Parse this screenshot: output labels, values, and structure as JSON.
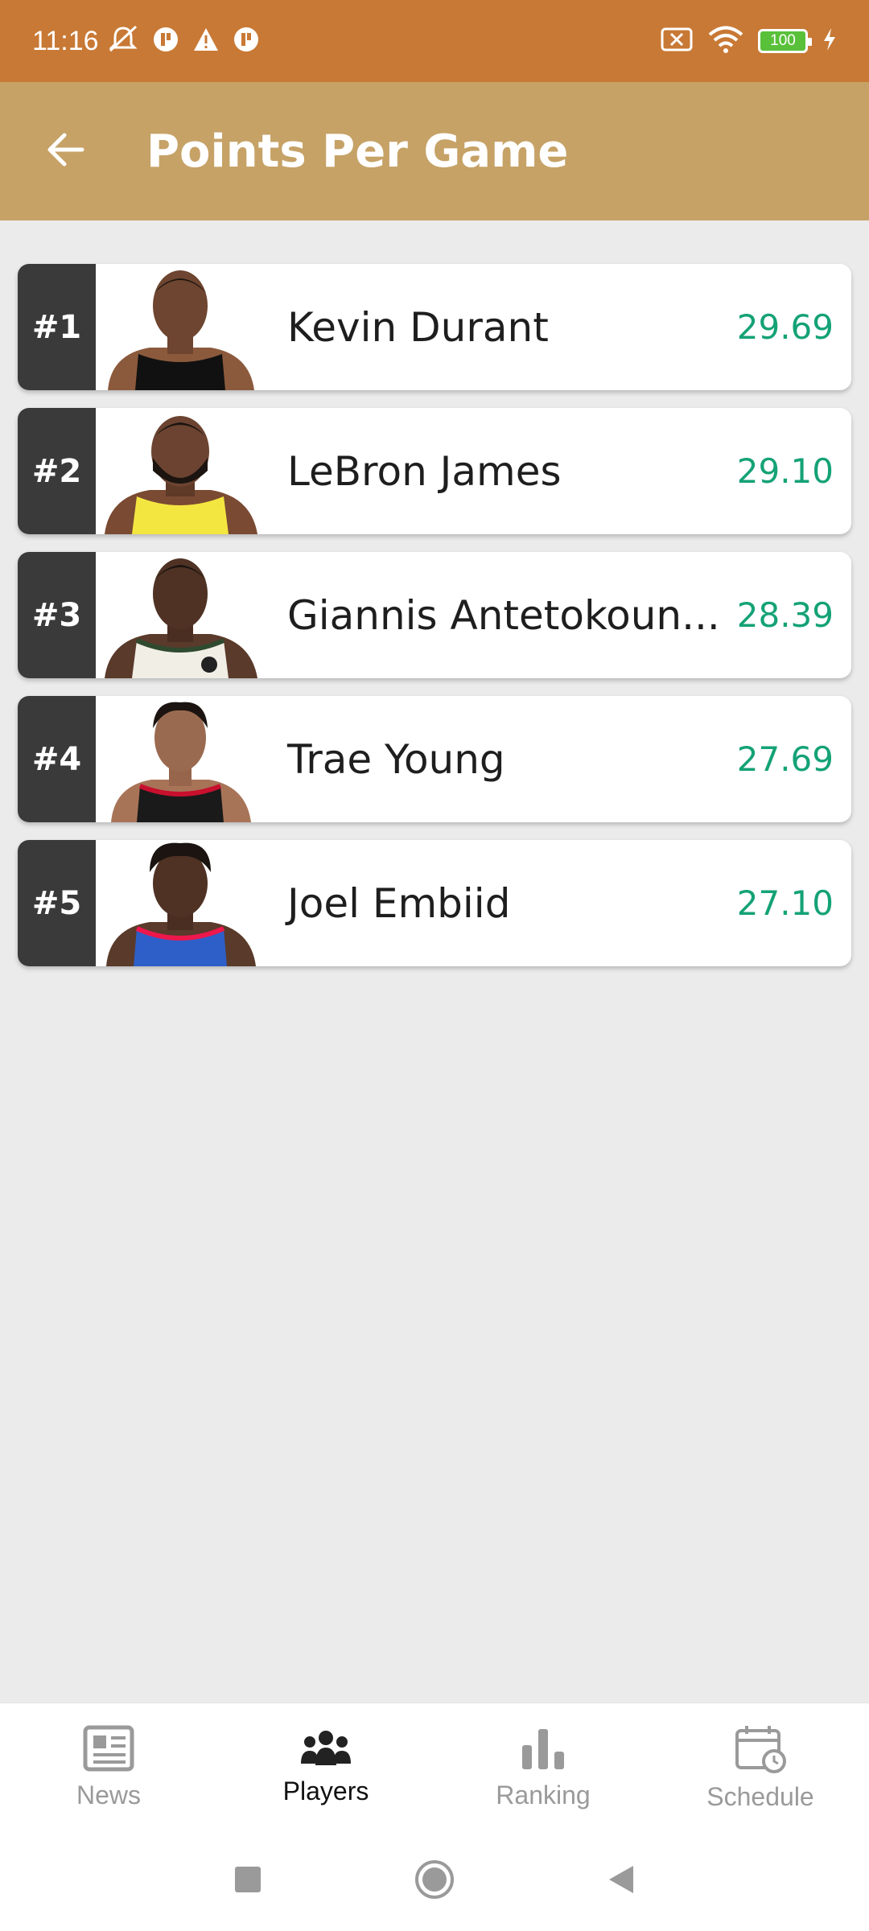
{
  "status_bar": {
    "time": "11:16",
    "battery": "100",
    "icons": [
      "mute-icon",
      "notification-icon",
      "warning-icon",
      "notification-icon",
      "no-sim-icon",
      "wifi-icon",
      "battery-icon",
      "charging-icon"
    ]
  },
  "app_bar": {
    "title": "Points Per Game",
    "back_icon": "arrow-left-icon"
  },
  "players": [
    {
      "rank": "#1",
      "name": "Kevin Durant",
      "ppg": "29.69",
      "jersey_color": "#111111"
    },
    {
      "rank": "#2",
      "name": "LeBron James",
      "ppg": "29.10",
      "jersey_color": "#F4E640"
    },
    {
      "rank": "#3",
      "name": "Giannis Antetokoun...",
      "ppg": "28.39",
      "jersey_color": "#F1EEE6"
    },
    {
      "rank": "#4",
      "name": "Trae Young",
      "ppg": "27.69",
      "jersey_color": "#1A1A1A"
    },
    {
      "rank": "#5",
      "name": "Joel Embiid",
      "ppg": "27.10",
      "jersey_color": "#2E5FC8"
    }
  ],
  "bottom_nav": {
    "items": [
      {
        "label": "News",
        "icon": "newspaper-icon",
        "active": false
      },
      {
        "label": "Players",
        "icon": "people-icon",
        "active": true
      },
      {
        "label": "Ranking",
        "icon": "bar-chart-icon",
        "active": false
      },
      {
        "label": "Schedule",
        "icon": "calendar-icon",
        "active": false
      }
    ]
  },
  "colors": {
    "status_bar": "#C87935",
    "app_bar": "#C6A267",
    "rank_badge": "#3A3A3A",
    "ppg_value": "#14A276",
    "background": "#EBEBEB"
  }
}
